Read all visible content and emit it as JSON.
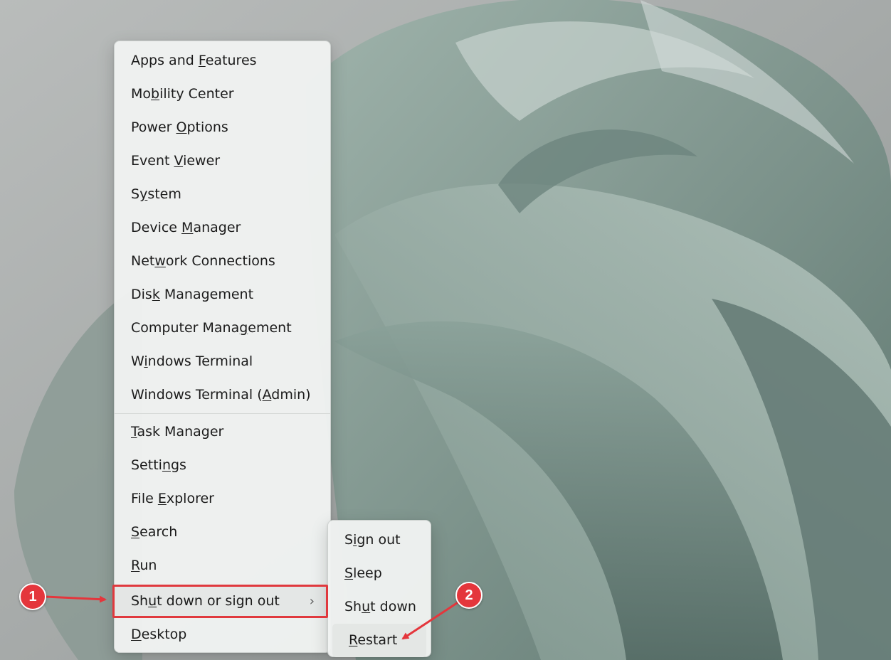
{
  "main_menu": {
    "items": [
      {
        "pre": "Apps and ",
        "key": "F",
        "post": "eatures"
      },
      {
        "pre": "Mo",
        "key": "b",
        "post": "ility Center"
      },
      {
        "pre": "Power ",
        "key": "O",
        "post": "ptions"
      },
      {
        "pre": "Event ",
        "key": "V",
        "post": "iewer"
      },
      {
        "pre": "S",
        "key": "y",
        "post": "stem"
      },
      {
        "pre": "Device ",
        "key": "M",
        "post": "anager"
      },
      {
        "pre": "Net",
        "key": "w",
        "post": "ork Connections"
      },
      {
        "pre": "Dis",
        "key": "k",
        "post": " Management"
      },
      {
        "pre": "Computer Mana",
        "key": "g",
        "post": "ement"
      },
      {
        "pre": "W",
        "key": "i",
        "post": "ndows Terminal"
      },
      {
        "pre": "Windows Terminal (",
        "key": "A",
        "post": "dmin)"
      }
    ],
    "items_lower": [
      {
        "pre": "",
        "key": "T",
        "post": "ask Manager"
      },
      {
        "pre": "Setti",
        "key": "n",
        "post": "gs"
      },
      {
        "pre": "File ",
        "key": "E",
        "post": "xplorer"
      },
      {
        "pre": "",
        "key": "S",
        "post": "earch"
      },
      {
        "pre": "",
        "key": "R",
        "post": "un"
      },
      {
        "pre": "Sh",
        "key": "u",
        "post": "t down or sign out"
      },
      {
        "pre": "",
        "key": "D",
        "post": "esktop"
      }
    ],
    "submenu_chevron": "›"
  },
  "sub_menu": {
    "items": [
      {
        "pre": "S",
        "key": "i",
        "post": "gn out"
      },
      {
        "pre": "",
        "key": "S",
        "post": "leep"
      },
      {
        "pre": "Sh",
        "key": "u",
        "post": "t down"
      },
      {
        "pre": "",
        "key": "R",
        "post": "estart"
      }
    ]
  },
  "annotations": {
    "badge_1": "1",
    "badge_2": "2",
    "color": "#e4363c"
  }
}
